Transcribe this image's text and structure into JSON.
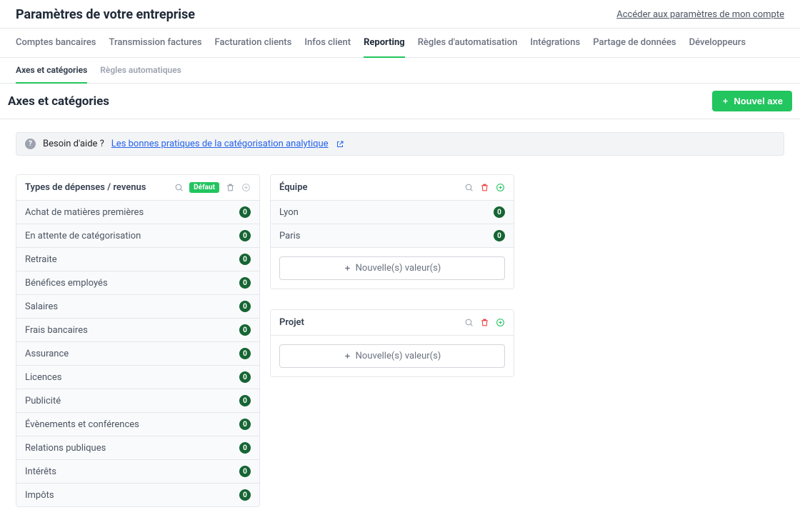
{
  "header": {
    "title": "Paramètres de votre entreprise",
    "account_link": "Accéder aux paramètres de mon compte"
  },
  "main_tabs": [
    "Comptes bancaires",
    "Transmission factures",
    "Facturation clients",
    "Infos client",
    "Reporting",
    "Règles d'automatisation",
    "Intégrations",
    "Partage de données",
    "Développeurs"
  ],
  "main_tab_active": "Reporting",
  "sub_tabs": [
    "Axes et catégories",
    "Règles automatiques"
  ],
  "sub_tab_active": "Axes et catégories",
  "section_title": "Axes et catégories",
  "new_axis_button": "Nouvel axe",
  "help": {
    "label": "Besoin d'aide ?",
    "link_text": "Les bonnes pratiques de la catégorisation analytique"
  },
  "axes": [
    {
      "name": "Types de dépenses / revenus",
      "is_default": true,
      "default_label": "Défaut",
      "deletable": false,
      "items": [
        {
          "label": "Achat de matières premières",
          "count": 0
        },
        {
          "label": "En attente de catégorisation",
          "count": 0
        },
        {
          "label": "Retraite",
          "count": 0
        },
        {
          "label": "Bénéfices employés",
          "count": 0
        },
        {
          "label": "Salaires",
          "count": 0
        },
        {
          "label": "Frais bancaires",
          "count": 0
        },
        {
          "label": "Assurance",
          "count": 0
        },
        {
          "label": "Licences",
          "count": 0
        },
        {
          "label": "Publicité",
          "count": 0
        },
        {
          "label": "Évènements et conférences",
          "count": 0
        },
        {
          "label": "Relations publiques",
          "count": 0
        },
        {
          "label": "Intérêts",
          "count": 0
        },
        {
          "label": "Impôts",
          "count": 0
        }
      ]
    },
    {
      "name": "Équipe",
      "is_default": false,
      "deletable": true,
      "items": [
        {
          "label": "Lyon",
          "count": 0
        },
        {
          "label": "Paris",
          "count": 0
        }
      ],
      "new_value_label": "Nouvelle(s) valeur(s)"
    },
    {
      "name": "Projet",
      "is_default": false,
      "deletable": true,
      "items": [],
      "new_value_label": "Nouvelle(s) valeur(s)"
    }
  ]
}
